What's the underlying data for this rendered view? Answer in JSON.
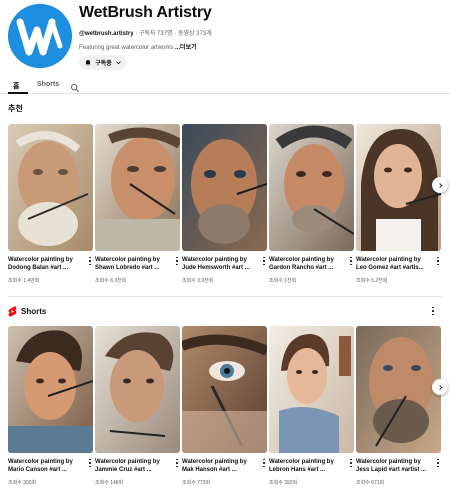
{
  "channel": {
    "name": "WetBrush Artistry",
    "handle": "@wetbrush.artistry",
    "stats": " · 구독자 737명 · 동영상 373개",
    "description": "Featuring great watercolor artworks ",
    "more_label": "...더보기",
    "subscribed_label": "구독중",
    "avatar_letter": "W",
    "avatar_color": "#1e8fe0"
  },
  "tabs": [
    {
      "label": "홈",
      "active": true
    },
    {
      "label": "Shorts",
      "active": false
    }
  ],
  "sections": {
    "recommended": {
      "title": "추천",
      "videos": [
        {
          "title": "Watercolor painting by Dodong Balan #art ...",
          "views": "조회수 1.4만회"
        },
        {
          "title": "Watercolor painting by Shawn Lobredo #art ...",
          "views": "조회수 6.3천회"
        },
        {
          "title": "Watercolor painting by Jude Hemsworth #art ...",
          "views": "조회수 3.9천회"
        },
        {
          "title": "Watercolor painting by Gardon Rancho #art ...",
          "views": "조회수 1천회"
        },
        {
          "title": "Watercolor painting by Leo Gomez #art #artis...",
          "views": "조회수 5.2천회"
        }
      ]
    },
    "shorts": {
      "title": "Shorts",
      "videos": [
        {
          "title": "Watercolor painting by Mario Canson #art ...",
          "views": "조회수 300회"
        },
        {
          "title": "Watercolor painting by Jammie Cruz #art ...",
          "views": "조회수 148회"
        },
        {
          "title": "Watercolor painting by Mak Hanson #art ...",
          "views": "조회수 773회"
        },
        {
          "title": "Watercolor painting by Lebron Hans #art ...",
          "views": "조회수 392회"
        },
        {
          "title": "Watercolor painting by Jess Lapid #art #artist ...",
          "views": "조회수 671회"
        }
      ]
    }
  },
  "icons": {
    "subscribe_bell": "bell-icon",
    "subscribe_chevron": "chevron-down-icon",
    "search": "search-icon",
    "shorts_logo": "shorts-icon",
    "more": "more-vert-icon",
    "next": "chevron-right-icon"
  },
  "colors": {
    "text_primary": "#0f0f0f",
    "text_secondary": "#606060",
    "shorts_red": "#ff0000",
    "subscribe_bg": "#f2f2f2"
  }
}
